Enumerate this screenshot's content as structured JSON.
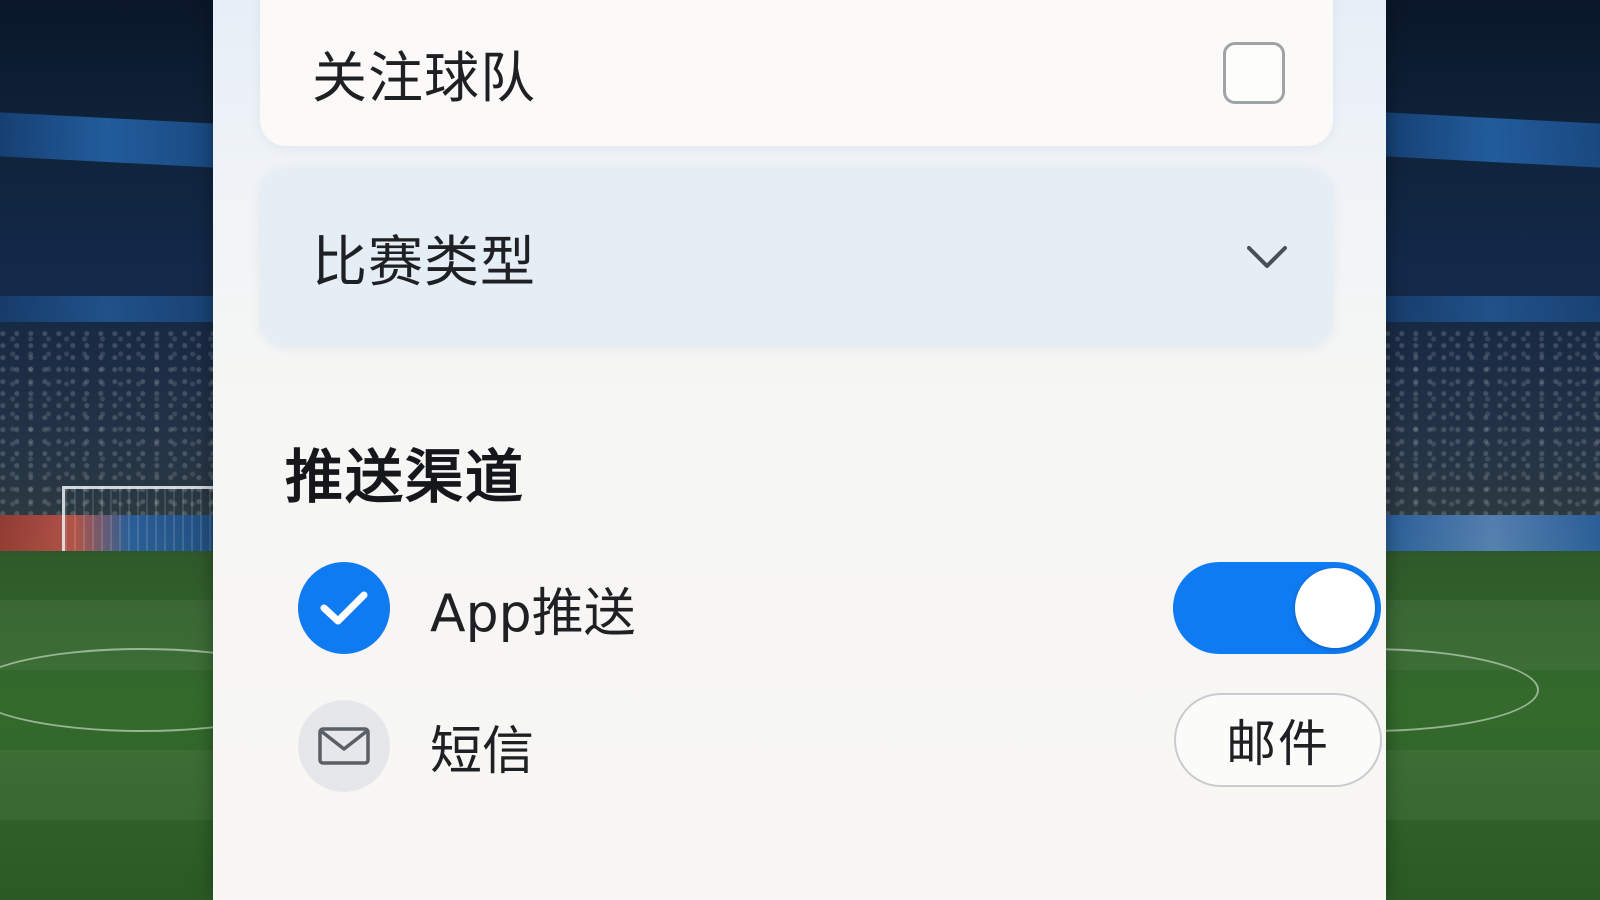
{
  "colors": {
    "accent": "#0f7bf2",
    "panel_background": "#f7f6f3",
    "dropdown_background": "#e5edf5"
  },
  "filters": {
    "follow_team": {
      "label": "关注球队",
      "checked": false,
      "icon": "checkbox-icon"
    },
    "match_type": {
      "label": "比赛类型",
      "icon": "chevron-down-icon"
    }
  },
  "push_channels": {
    "title": "推送渠道",
    "app": {
      "label": "App推送",
      "selected": true,
      "icon": "check-circle-icon",
      "toggle_on": true
    },
    "sms": {
      "label": "短信",
      "selected": false,
      "icon": "mail-icon",
      "button_label": "邮件"
    }
  }
}
